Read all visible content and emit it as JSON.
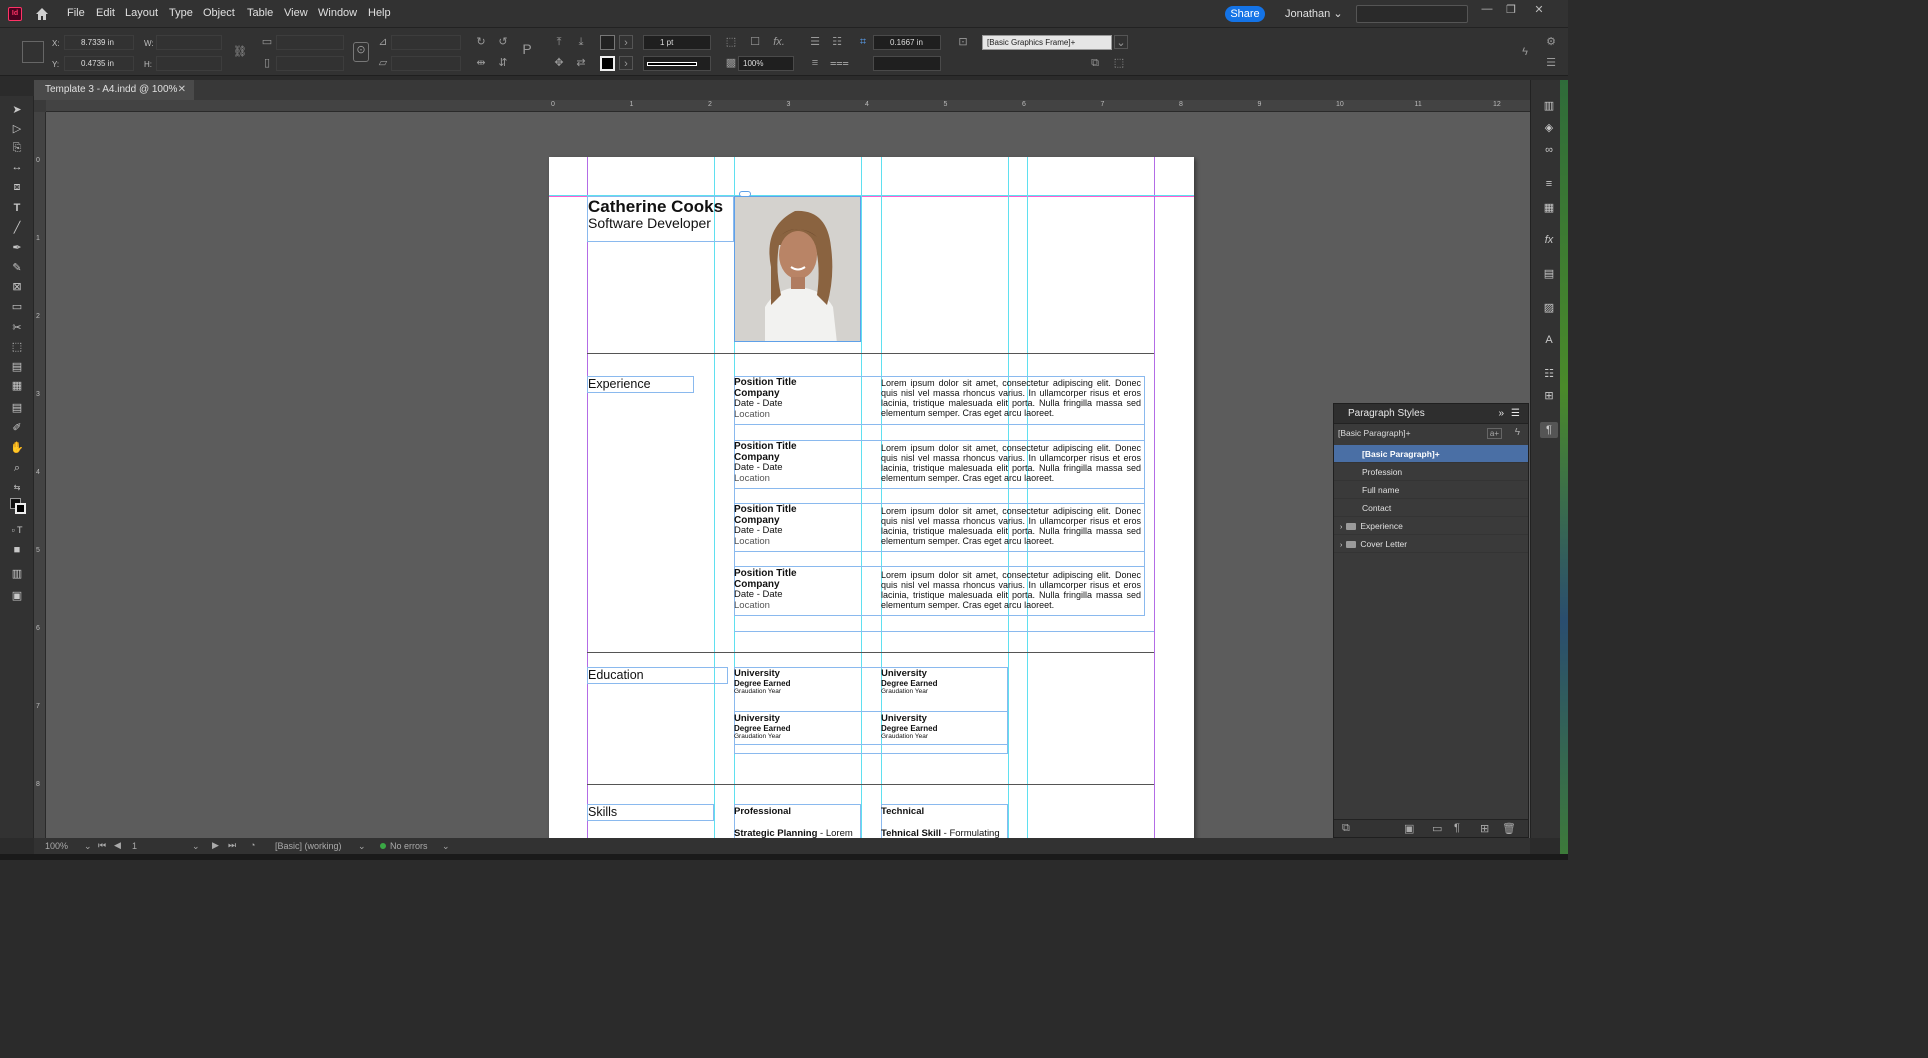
{
  "menubar": {
    "app_logo": "Id",
    "items": [
      "File",
      "Edit",
      "Layout",
      "Type",
      "Object",
      "Table",
      "View",
      "Window",
      "Help"
    ],
    "share_label": "Share",
    "user_label": "Jonathan"
  },
  "controlbar": {
    "x_label": "X:",
    "x_value": "8.7339 in",
    "y_label": "Y:",
    "y_value": "0.4735 in",
    "w_label": "W:",
    "h_label": "H:",
    "stroke_weight": "1 pt",
    "opacity": "100%",
    "gap_value": "0.1667 in",
    "object_style": "[Basic Graphics Frame]+"
  },
  "document_tab": {
    "title": "Template 3 - A4.indd @ 100%",
    "close": "✕"
  },
  "ruler_h": [
    "0",
    "1",
    "2",
    "3",
    "4",
    "5",
    "6",
    "7",
    "8",
    "9",
    "10",
    "11",
    "12"
  ],
  "ruler_v": [
    "0",
    "1",
    "2",
    "3",
    "4",
    "5",
    "6",
    "7",
    "8"
  ],
  "resume": {
    "name": "Catherine Cooks",
    "profession": "Software Developer",
    "experience_head": "Experience",
    "positions": [
      {
        "title": "Position Title",
        "company": "Company",
        "dates": "Date - Date",
        "location": "Location",
        "desc": "Lorem ipsum dolor sit amet, consectetur adipiscing elit. Donec quis nisl vel massa rhoncus varius. In ullamcorper risus et eros lacinia, tristique malesuada elit porta. Nulla fringilla massa sed elementum semper. Cras eget arcu laoreet."
      },
      {
        "title": "Position Title",
        "company": "Company",
        "dates": "Date - Date",
        "location": "Location",
        "desc": "Lorem ipsum dolor sit amet, consectetur adipiscing elit. Donec quis nisl vel massa rhoncus varius. In ullamcorper risus et eros lacinia, tristique malesuada elit porta. Nulla fringilla massa sed elementum semper. Cras eget arcu laoreet."
      },
      {
        "title": "Position Title",
        "company": "Company",
        "dates": "Date - Date",
        "location": "Location",
        "desc": "Lorem ipsum dolor sit amet, consectetur adipiscing elit. Donec quis nisl vel massa rhoncus varius. In ullamcorper risus et eros lacinia, tristique malesuada elit porta. Nulla fringilla massa sed elementum semper. Cras eget arcu laoreet."
      },
      {
        "title": "Position Title",
        "company": "Company",
        "dates": "Date - Date",
        "location": "Location",
        "desc": "Lorem ipsum dolor sit amet, consectetur adipiscing elit. Donec quis nisl vel massa rhoncus varius. In ullamcorper risus et eros lacinia, tristique malesuada elit porta. Nulla fringilla massa sed elementum semper. Cras eget arcu laoreet."
      }
    ],
    "education_head": "Education",
    "education": [
      {
        "university": "University",
        "degree": "Degree Earned",
        "year": "Graudation Year"
      },
      {
        "university": "University",
        "degree": "Degree Earned",
        "year": "Graudation Year"
      },
      {
        "university": "University",
        "degree": "Degree Earned",
        "year": "Graudation Year"
      },
      {
        "university": "University",
        "degree": "Degree Earned",
        "year": "Graudation Year"
      }
    ],
    "skills_head": "Skills",
    "skills_professional": "Professional",
    "skills_technical": "Technical",
    "skill_prof_item_bold": "Strategic Planning",
    "skill_prof_item_rest": " - Lorem",
    "skill_tech_item_bold": "Tehnical Skill",
    "skill_tech_item_rest": " - Formulating"
  },
  "paragraph_styles": {
    "title": "Paragraph Styles",
    "current": "[Basic Paragraph]+",
    "items": [
      {
        "label": "[Basic Paragraph]+",
        "selected": true
      },
      {
        "label": "Profession"
      },
      {
        "label": "Full name"
      },
      {
        "label": "Contact"
      },
      {
        "label": "Experience",
        "folder": true
      },
      {
        "label": "Cover Letter",
        "folder": true
      }
    ]
  },
  "statusbar": {
    "zoom": "100%",
    "page": "1",
    "profile": "[Basic] (working)",
    "preflight": "No errors"
  },
  "colors": {
    "accent": "#1473e6",
    "guide": "#5fe0f0",
    "margin": "#b36ce6",
    "top_margin": "#ff5fd0",
    "selected_style": "#4a6fa5"
  }
}
